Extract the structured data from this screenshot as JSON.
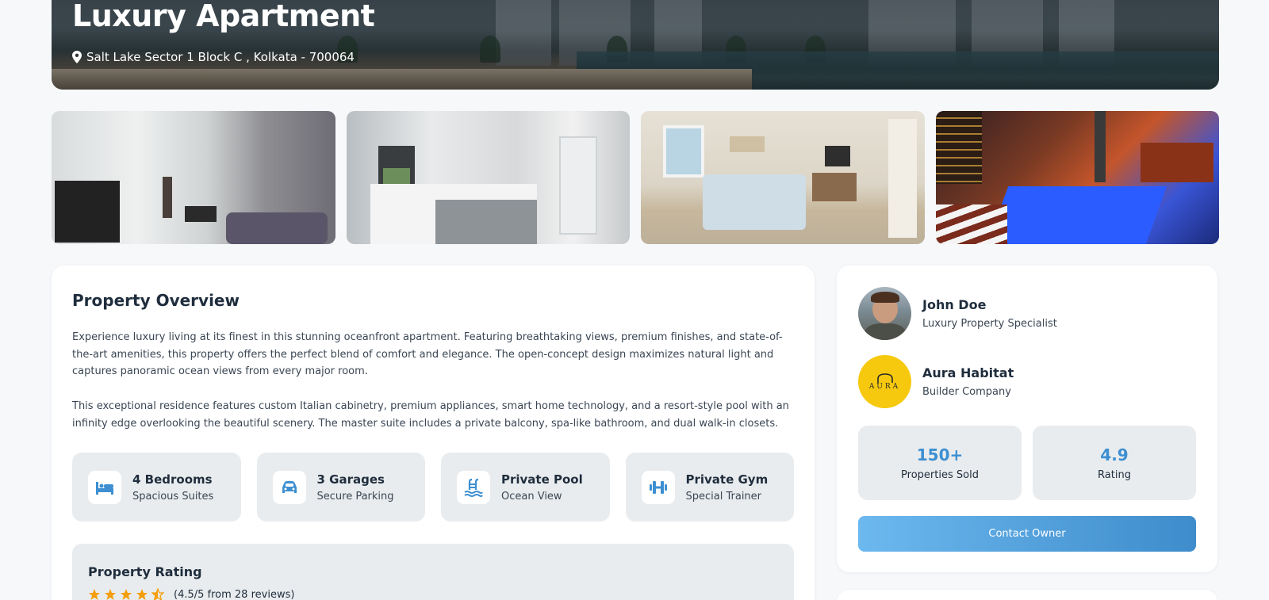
{
  "hero": {
    "title": "Luxury Apartment",
    "location": "Salt Lake Sector 1 Block C , Kolkata - 700064"
  },
  "gallery": [
    {
      "alt": "living-room"
    },
    {
      "alt": "kitchen"
    },
    {
      "alt": "bedroom"
    },
    {
      "alt": "rooftop-pool"
    }
  ],
  "overview": {
    "title": "Property Overview",
    "paragraph1": "Experience luxury living at its finest in this stunning oceanfront apartment. Featuring breathtaking views, premium finishes, and state-of-the-art amenities, this property offers the perfect blend of comfort and elegance. The open-concept design maximizes natural light and captures panoramic ocean views from every major room.",
    "paragraph2": "This exceptional residence features custom Italian cabinetry, premium appliances, smart home technology, and a resort-style pool with an infinity edge overlooking the beautiful scenery. The master suite includes a private balcony, spa-like bathroom, and dual walk-in closets.",
    "features": [
      {
        "icon": "bed-icon",
        "title": "4 Bedrooms",
        "subtitle": "Spacious Suites"
      },
      {
        "icon": "car-icon",
        "title": "3 Garages",
        "subtitle": "Secure Parking"
      },
      {
        "icon": "pool-icon",
        "title": "Private Pool",
        "subtitle": "Ocean View"
      },
      {
        "icon": "dumbbell-icon",
        "title": "Private Gym",
        "subtitle": "Special Trainer"
      }
    ],
    "rating": {
      "title": "Property Rating",
      "stars": 4.5,
      "text": "(4.5/5 from 28 reviews)"
    }
  },
  "agent": {
    "name": "John Doe",
    "role": "Luxury Property Specialist"
  },
  "builder": {
    "name": "Aura Habitat",
    "role": "Builder Company",
    "logo_text": "AURA"
  },
  "stats": [
    {
      "value": "150+",
      "label": "Properties Sold"
    },
    {
      "value": "4.9",
      "label": "Rating"
    }
  ],
  "contact_label": "Contact Owner",
  "colors": {
    "accent": "#3d8fd1",
    "star": "#f59e0b",
    "logo_bg": "#f6c90e"
  }
}
